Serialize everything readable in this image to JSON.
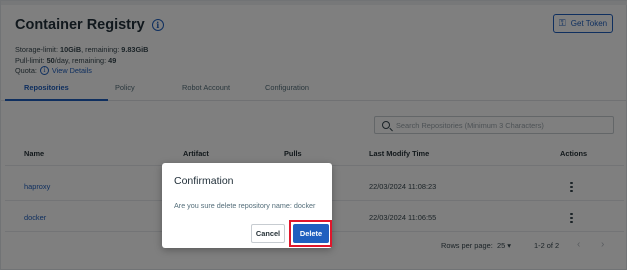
{
  "header": {
    "title": "Container Registry",
    "get_token_label": "Get Token",
    "storage_label": "Storage-limit:",
    "storage_limit": "10GiB",
    "storage_remaining_label": ", remaining:",
    "storage_remaining": "9.83GiB",
    "pull_label": "Pull-limit:",
    "pull_limit": "50",
    "pull_suffix": "/day, remaining:",
    "pull_remaining": "49",
    "quota_label": "Quota:",
    "view_details": "View Details"
  },
  "tabs": [
    "Repositories",
    "Policy",
    "Robot Account",
    "Configuration"
  ],
  "active_tab": "Repositories",
  "search": {
    "placeholder": "Search Repositories (Minimum 3 Characters)"
  },
  "table": {
    "columns": [
      "Name",
      "Artifact",
      "Pulls",
      "Last Modify Time",
      "Actions"
    ],
    "rows": [
      {
        "name": "haproxy",
        "last_modify": "22/03/2024 11:08:23"
      },
      {
        "name": "docker",
        "last_modify": "22/03/2024 11:06:55"
      }
    ]
  },
  "pagination": {
    "rows_per_page_label": "Rows per page:",
    "rows_per_page": "25",
    "range": "1-2 of 2"
  },
  "dialog": {
    "title": "Confirmation",
    "message": "Are you sure delete repository name: docker",
    "cancel_label": "Cancel",
    "delete_label": "Delete"
  },
  "colors": {
    "accent": "#1f5fbf",
    "highlight": "#e0162b",
    "overlay": "rgba(0,0,0,0.5)"
  },
  "icons": {
    "title_info": "info-icon",
    "token": "key-icon",
    "search": "search-icon",
    "actions": "kebab-menu-icon",
    "pager_prev": "chevron-left-icon",
    "pager_next": "chevron-right-icon"
  }
}
